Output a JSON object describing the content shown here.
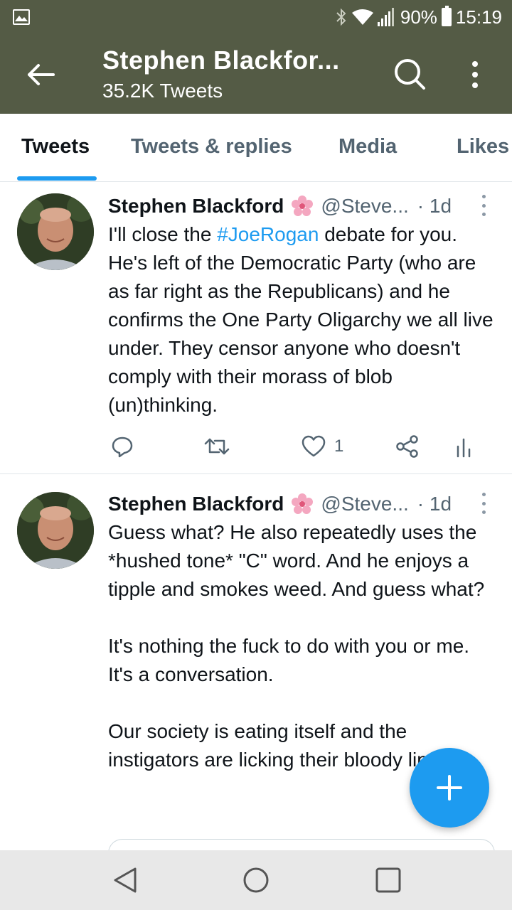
{
  "status_bar": {
    "battery_percent": "90%",
    "time": "15:19",
    "icons": [
      "gallery-icon",
      "bluetooth-icon",
      "wifi-icon",
      "signal-icon",
      "battery-icon"
    ]
  },
  "header": {
    "title": "Stephen Blackfor...",
    "subtitle": "35.2K Tweets",
    "icons": {
      "back": "arrow-left-icon",
      "search": "search-icon",
      "more": "more-vertical-icon"
    }
  },
  "tabs": [
    {
      "label": "Tweets",
      "active": true
    },
    {
      "label": "Tweets & replies",
      "active": false
    },
    {
      "label": "Media",
      "active": false
    },
    {
      "label": "Likes",
      "active": false
    }
  ],
  "colors": {
    "header_bg": "#545b45",
    "accent": "#1d9bf0",
    "muted": "#536471",
    "text": "#0f1419"
  },
  "tweets": [
    {
      "name": "Stephen Blackford",
      "handle": "@Steve...",
      "time": "· 1d",
      "text_before_tag": "I'll close the ",
      "hashtag": "#JoeRogan",
      "text_after_tag": " debate for you. He's left of the Democratic Party (who are as far right as the Republicans) and he confirms the One Party Oligarchy we all live under. They censor anyone who doesn't comply with their morass of blob (un)thinking.",
      "likes": "1"
    },
    {
      "name": "Stephen Blackford",
      "handle": "@Steve...",
      "time": "· 1d",
      "paragraphs": [
        "Guess what? He also repeatedly uses the *hushed tone* \"C\" word. And he enjoys a tipple and smokes weed. And guess what?",
        "It's nothing the fuck to do with you or me. It's a conversation.",
        "Our society is eating itself and the instigators are licking their bloody lips."
      ]
    }
  ],
  "nav": {
    "icons": [
      "back-triangle-icon",
      "home-circle-icon",
      "recents-square-icon"
    ]
  }
}
